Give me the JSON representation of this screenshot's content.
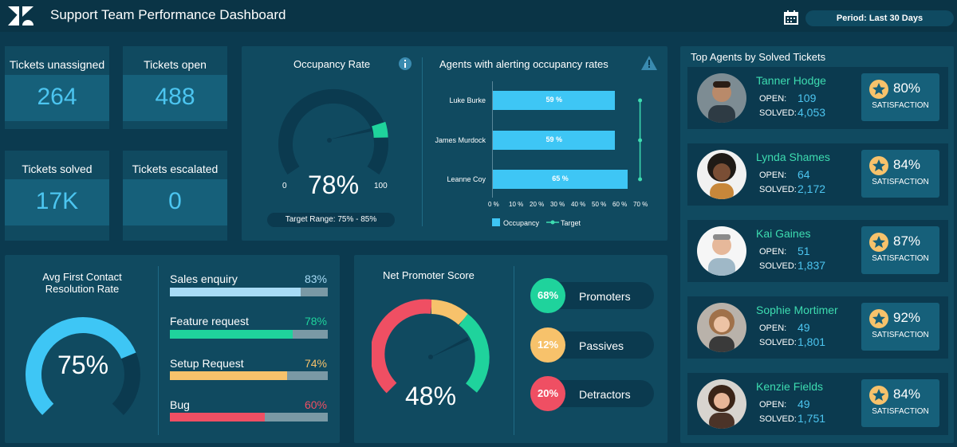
{
  "header": {
    "title": "Support Team Performance Dashboard",
    "period": "Period: Last 30 Days",
    "logo_icon": "zendesk-logo-icon",
    "calendar_icon": "calendar-icon"
  },
  "kpis": [
    {
      "label": "Tickets unassigned",
      "value": "264"
    },
    {
      "label": "Tickets open",
      "value": "488"
    },
    {
      "label": "Tickets solved",
      "value": "17K"
    },
    {
      "label": "Tickets escalated",
      "value": "0"
    }
  ],
  "occupancy": {
    "title": "Occupancy Rate",
    "value": "78%",
    "value_fraction": 0.78,
    "min": "0",
    "max": "100",
    "target_range": "Target Range: 75% - 85%"
  },
  "alerting": {
    "title": "Agents with alerting occupancy rates",
    "legend_occupancy": "Occupancy",
    "legend_target": "Target",
    "chart_data": {
      "type": "bar",
      "orientation": "horizontal",
      "categories": [
        "Luke Burke",
        "James Murdock",
        "Leanne Coy"
      ],
      "series": [
        {
          "name": "Occupancy",
          "values": [
            59,
            59,
            65
          ],
          "labels": [
            "59 %",
            "59 %",
            "65 %"
          ]
        },
        {
          "name": "Target",
          "values": [
            71,
            71,
            71
          ]
        }
      ],
      "xticks": [
        "0 %",
        "10 %",
        "20 %",
        "30 %",
        "40 %",
        "50 %",
        "60 %",
        "70 %"
      ],
      "xlim": [
        0,
        80
      ]
    }
  },
  "fcr": {
    "title_line1": "Avg First Contact",
    "title_line2": "Resolution Rate",
    "value": "75%",
    "value_fraction": 0.75,
    "rows": [
      {
        "label": "Sales enquiry",
        "pct": "83%",
        "value": 0.83,
        "color": "#a8dcf6"
      },
      {
        "label": "Feature request",
        "pct": "78%",
        "value": 0.78,
        "color": "#1fd39c"
      },
      {
        "label": "Setup Request",
        "pct": "74%",
        "value": 0.74,
        "color": "#f7c26b"
      },
      {
        "label": "Bug",
        "pct": "60%",
        "value": 0.6,
        "color": "#ef4f63"
      }
    ]
  },
  "nps": {
    "title": "Net Promoter Score",
    "value": "48%",
    "items": [
      {
        "pct": "68%",
        "label": "Promoters",
        "color": "#1fd39c"
      },
      {
        "pct": "12%",
        "label": "Passives",
        "color": "#f7c26b"
      },
      {
        "pct": "20%",
        "label": "Detractors",
        "color": "#ef4f63"
      }
    ]
  },
  "agents": {
    "title": "Top Agents by Solved Tickets",
    "open_key": "OPEN:",
    "solved_key": "SOLVED:",
    "sat_label": "SATISFACTION",
    "list": [
      {
        "name": "Tanner Hodge",
        "open": "109",
        "solved": "4,053",
        "satisfaction": "80%"
      },
      {
        "name": "Lynda Shames",
        "open": "64",
        "solved": "2,172",
        "satisfaction": "84%"
      },
      {
        "name": "Kai Gaines",
        "open": "51",
        "solved": "1,837",
        "satisfaction": "87%"
      },
      {
        "name": "Sophie Mortimer",
        "open": "49",
        "solved": "1,801",
        "satisfaction": "92%"
      },
      {
        "name": "Kenzie Fields",
        "open": "49",
        "solved": "1,751",
        "satisfaction": "84%"
      }
    ]
  }
}
